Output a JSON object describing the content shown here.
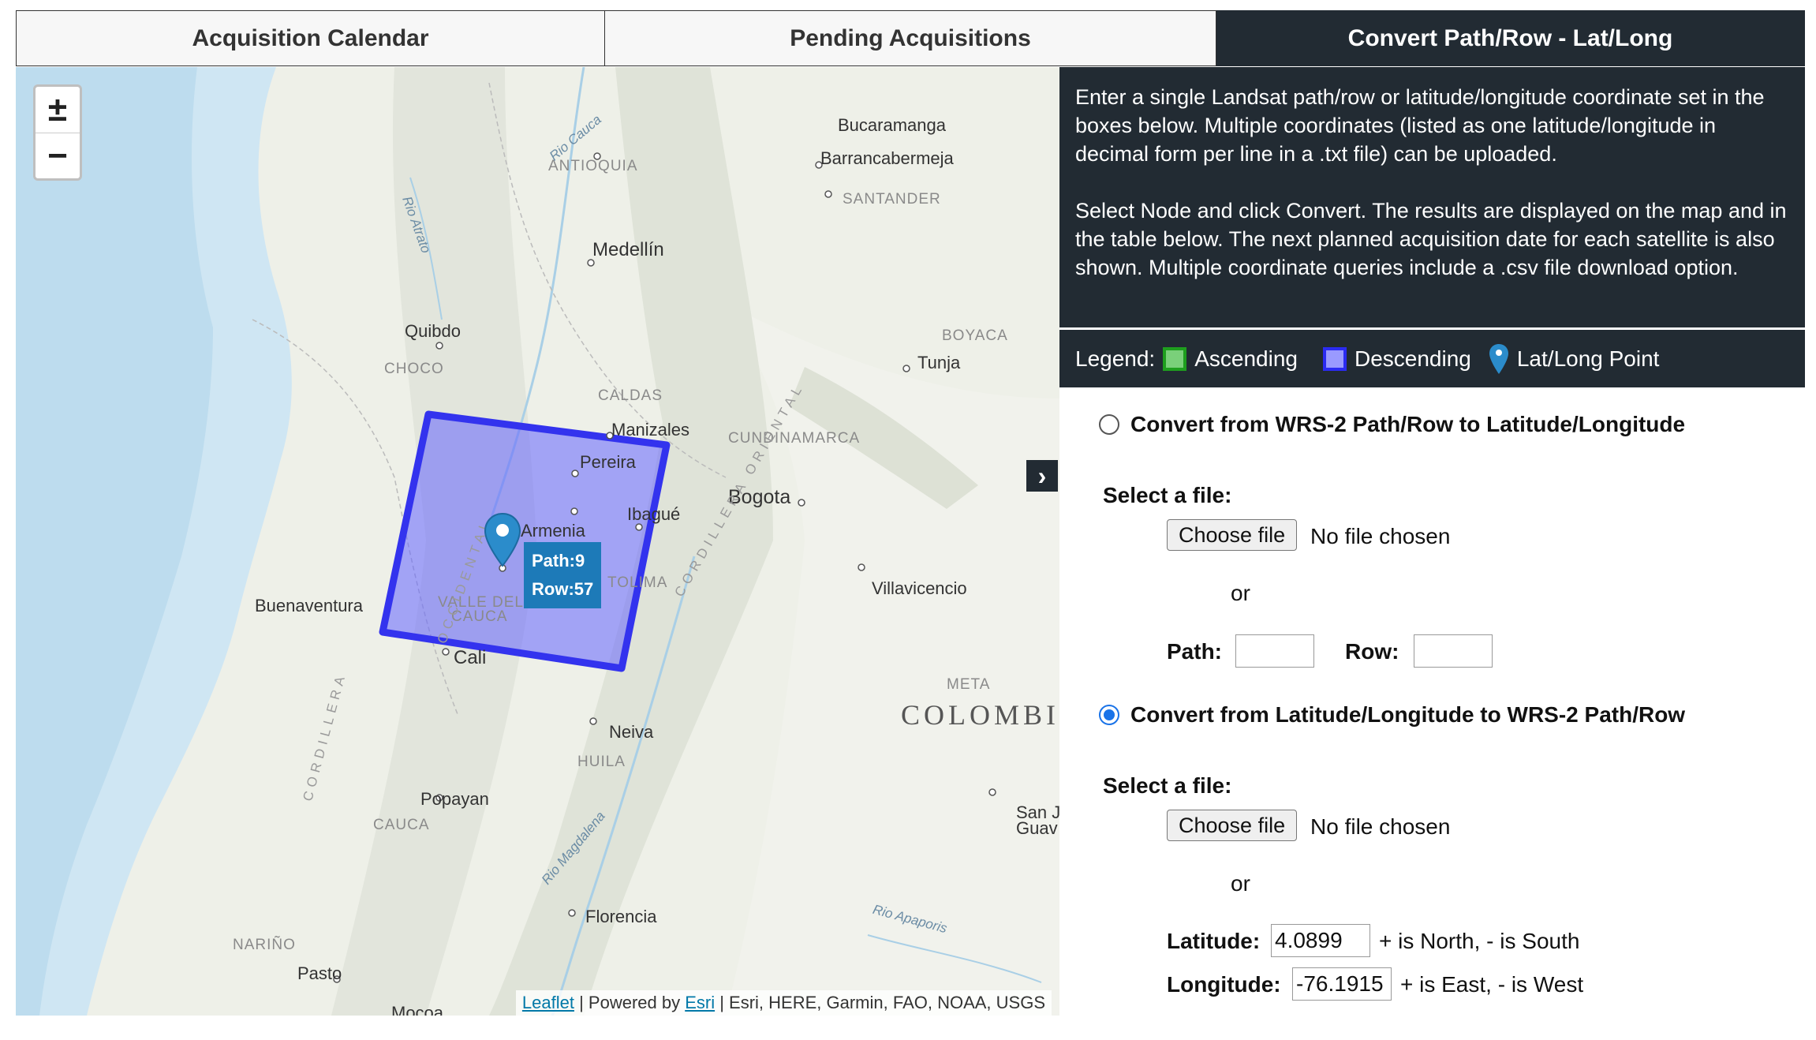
{
  "tabs": [
    {
      "label": "Acquisition Calendar"
    },
    {
      "label": "Pending Acquisitions"
    },
    {
      "label": "Convert Path/Row - Lat/Long"
    }
  ],
  "map": {
    "zoom_in": "±",
    "zoom_out": "−",
    "tooltip": {
      "path": "Path:9",
      "row": "Row:57"
    },
    "expander": "›",
    "labels": [
      {
        "text": "Bucaramanga",
        "cls": "city"
      },
      {
        "text": "Barrancabermeja",
        "cls": "city"
      },
      {
        "text": "SANTANDER",
        "cls": "region"
      },
      {
        "text": "ANTIOQUIA",
        "cls": "region"
      },
      {
        "text": "Medellín",
        "cls": "city"
      },
      {
        "text": "Quibdo",
        "cls": "city"
      },
      {
        "text": "CHOCO",
        "cls": "region"
      },
      {
        "text": "BOYACA",
        "cls": "region"
      },
      {
        "text": "Tunja",
        "cls": "city"
      },
      {
        "text": "CALDAS",
        "cls": "region"
      },
      {
        "text": "Manizales",
        "cls": "city"
      },
      {
        "text": "CUNDINAMARCA",
        "cls": "region"
      },
      {
        "text": "Pereira",
        "cls": "city"
      },
      {
        "text": "Bogota",
        "cls": "city"
      },
      {
        "text": "Ibagué",
        "cls": "city"
      },
      {
        "text": "Armenia",
        "cls": "city"
      },
      {
        "text": "TOLIMA",
        "cls": "region"
      },
      {
        "text": "Villavicencio",
        "cls": "city"
      },
      {
        "text": "Buenaventura",
        "cls": "city"
      },
      {
        "text": "VALLE DEL",
        "cls": "region"
      },
      {
        "text": "CAUCA",
        "cls": "region"
      },
      {
        "text": "Cali",
        "cls": "city"
      },
      {
        "text": "META",
        "cls": "region"
      },
      {
        "text": "COLOMBI",
        "cls": "country"
      },
      {
        "text": "Neiva",
        "cls": "city"
      },
      {
        "text": "HUILA",
        "cls": "region"
      },
      {
        "text": "Popayan",
        "cls": "city"
      },
      {
        "text": "CAUCA",
        "cls": "region"
      },
      {
        "text": "San J",
        "cls": "city"
      },
      {
        "text": "Guav",
        "cls": "city"
      },
      {
        "text": "Florencia",
        "cls": "city"
      },
      {
        "text": "NARIÑO",
        "cls": "region"
      },
      {
        "text": "Pasto",
        "cls": "city"
      },
      {
        "text": "Mocoa",
        "cls": "city"
      },
      {
        "text": "Rio Cauca",
        "cls": "river"
      },
      {
        "text": "Rio Atrato",
        "cls": "river"
      },
      {
        "text": "Rio Magdalena",
        "cls": "river"
      },
      {
        "text": "Rio Apaporis",
        "cls": "river"
      },
      {
        "text": "CORDILLERA ORIENTAL",
        "cls": "range"
      },
      {
        "text": "CORDILLERA",
        "cls": "range"
      },
      {
        "text": "OCCIDENTAL",
        "cls": "range"
      }
    ],
    "attribution": {
      "leaflet": "Leaflet",
      "sep1": " | Powered by ",
      "esri": "Esri",
      "rest": " | Esri, HERE, Garmin, FAO, NOAA, USGS"
    }
  },
  "info": {
    "p1": "Enter a single Landsat path/row or latitude/longitude coordinate set in the boxes below. Multiple coordinates (listed as one latitude/longitude in decimal form per line in a .txt file) can be uploaded.",
    "p2": "Select Node and click Convert. The results are displayed on the map and in the table below. The next planned acquisition date for each satellite is also shown. Multiple coordinate queries include a .csv file download option."
  },
  "legend": {
    "title": "Legend:",
    "ascending": "Ascending",
    "descending": "Descending",
    "point": "Lat/Long Point"
  },
  "form": {
    "option1": "Convert from WRS-2 Path/Row to Latitude/Longitude",
    "option2": "Convert from Latitude/Longitude to WRS-2 Path/Row",
    "select_file": "Select a file:",
    "choose_file": "Choose file",
    "no_file": "No file chosen",
    "or": "or",
    "path_label": "Path:",
    "row_label": "Row:",
    "path_value": "",
    "row_value": "",
    "latitude_label": "Latitude:",
    "latitude_value": "4.0899",
    "latitude_hint": "+ is North, - is South",
    "longitude_label": "Longitude:",
    "longitude_value": "-76.1915",
    "longitude_hint": "+ is East, - is West",
    "selected_option": 2
  },
  "colors": {
    "dark": "#222b33",
    "ascending": "#1e9e1e",
    "descending": "#2b2bf2",
    "pin": "#1d7ab8"
  }
}
